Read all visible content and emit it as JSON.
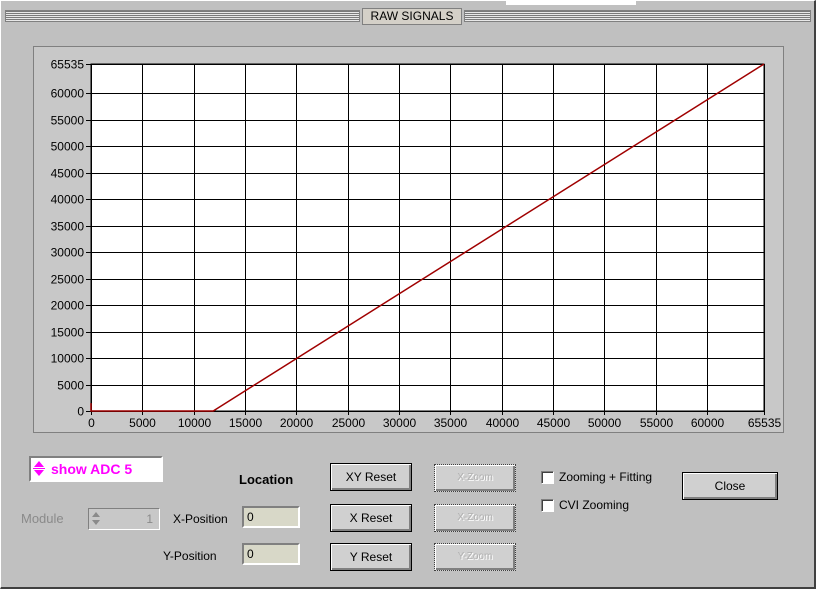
{
  "window": {
    "title": "RAW SIGNALS"
  },
  "chart_data": {
    "type": "line",
    "xlim": [
      0,
      65535
    ],
    "ylim": [
      0,
      65535
    ],
    "x_ticks": [
      "0",
      "5000",
      "10000",
      "15000",
      "20000",
      "25000",
      "30000",
      "35000",
      "40000",
      "45000",
      "50000",
      "55000",
      "60000",
      "65535"
    ],
    "y_ticks": [
      "0",
      "5000",
      "10000",
      "15000",
      "20000",
      "25000",
      "30000",
      "35000",
      "40000",
      "45000",
      "50000",
      "55000",
      "60000",
      "65535"
    ],
    "grid": true,
    "colors": {
      "line": "#a00000",
      "plot_bg": "#ffffff",
      "grid": "#000000"
    },
    "series": [
      {
        "x": [
          0,
          0,
          11900,
          65535
        ],
        "y": [
          1500,
          0,
          0,
          65535
        ]
      }
    ]
  },
  "controls": {
    "adc_selector": "show ADC 5",
    "module_label": "Module",
    "module_value": "1",
    "location_title": "Location",
    "x_position_label": "X-Position",
    "x_position_value": "0",
    "y_position_label": "Y-Position",
    "y_position_value": "0",
    "xy_reset": "XY Reset",
    "x_reset": "X Reset",
    "y_reset": "Y Reset",
    "xy_zoom": "X-Zoom",
    "x_zoom": "X-Zoom",
    "y_zoom": "Y-Zoom",
    "zooming_fitting": "Zooming + Fitting",
    "cvi_zooming": "CVI Zooming",
    "close": "Close"
  },
  "colors": {
    "window_bg": "#c0c0c0",
    "accent": "#ff00ff"
  },
  "icons": {
    "spin": "up-down-arrows-icon"
  }
}
